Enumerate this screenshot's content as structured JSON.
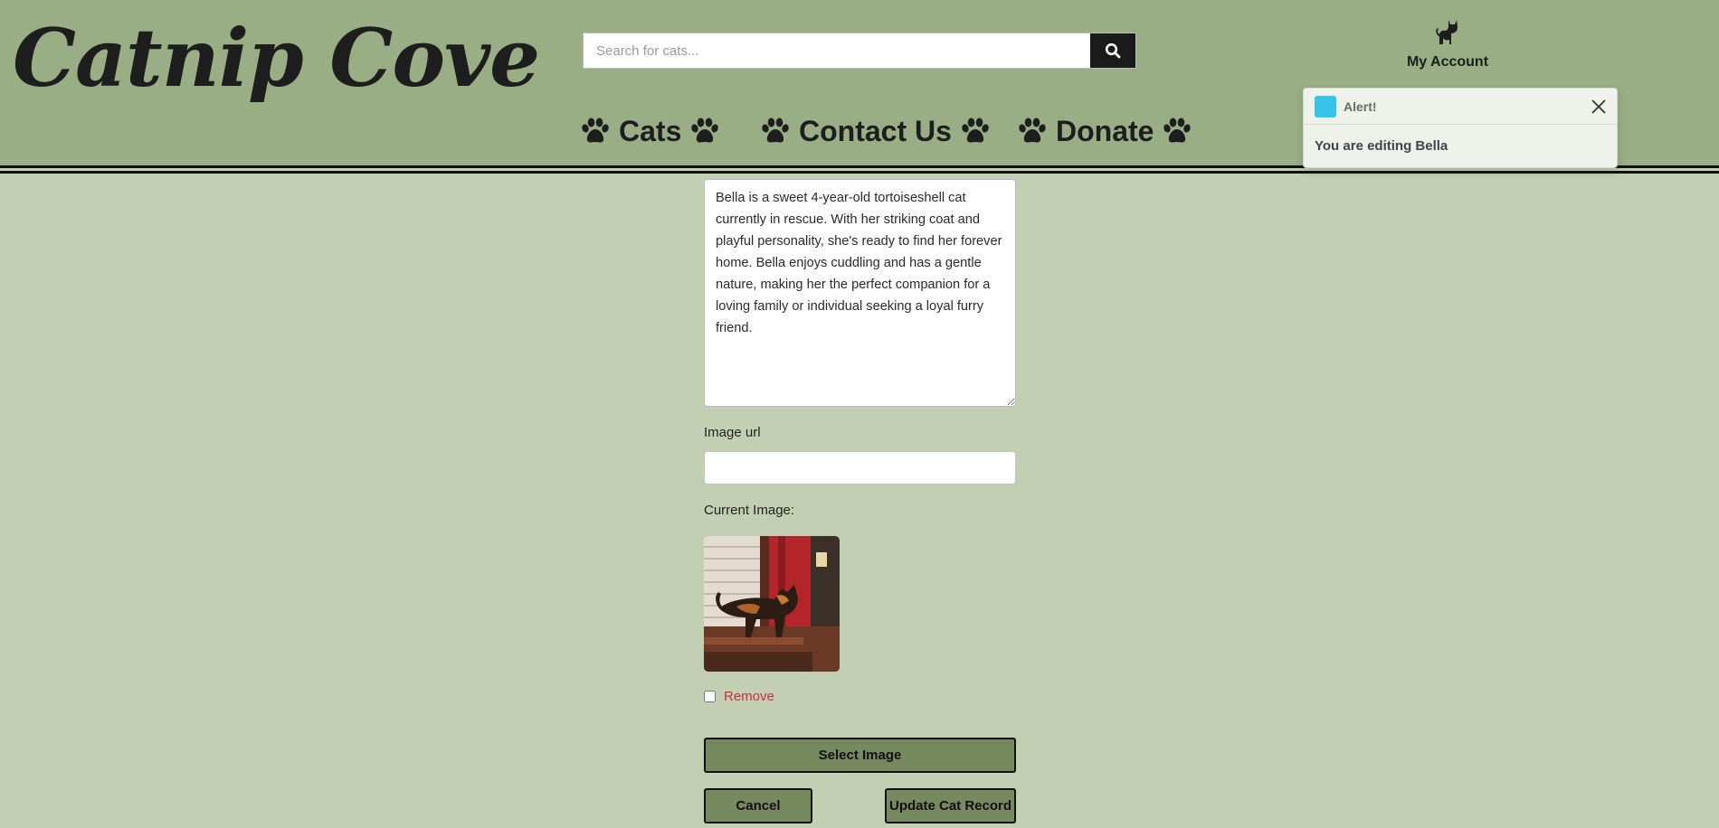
{
  "brand": {
    "logo_text": "Catnip Cove"
  },
  "search": {
    "placeholder": "Search for cats..."
  },
  "account": {
    "label": "My Account"
  },
  "nav": [
    {
      "label": "Cats"
    },
    {
      "label": "Contact Us"
    },
    {
      "label": "Donate"
    }
  ],
  "alert": {
    "title": "Alert!",
    "message": "You are editing Bella",
    "accent_color": "#36c4ea"
  },
  "form": {
    "description": "Bella is a sweet 4-year-old tortoiseshell cat currently in rescue. With her striking coat and playful personality, she's ready to find her forever home. Bella enjoys cuddling and has a gentle nature, making her the perfect companion for a loving family or individual seeking a loyal furry friend.",
    "image_url_label": "Image url",
    "image_url_value": "",
    "current_image_label": "Current Image:",
    "remove_label": "Remove",
    "select_image_label": "Select Image",
    "cancel_label": "Cancel",
    "update_label": "Update Cat Record"
  },
  "colors": {
    "header_bg": "#99ae84",
    "page_bg": "#c2cfb2",
    "button_bg": "#77895f",
    "remove_text": "#c8323f"
  },
  "icons": [
    "search-icon",
    "cat-icon",
    "paw-icon",
    "close-icon"
  ]
}
